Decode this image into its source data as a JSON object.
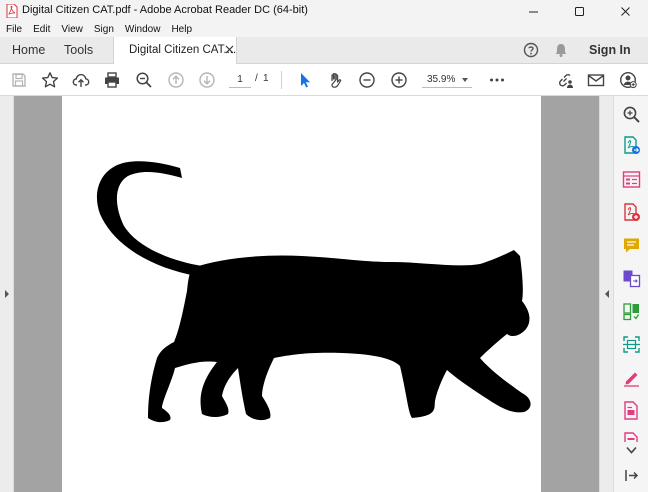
{
  "window": {
    "title": "Digital Citizen CAT.pdf - Adobe Acrobat Reader DC (64-bit)"
  },
  "menu": {
    "items": [
      "File",
      "Edit",
      "View",
      "Sign",
      "Window",
      "Help"
    ]
  },
  "tabs": {
    "home": "Home",
    "tools": "Tools",
    "document": "Digital Citizen CAT....",
    "sign_in": "Sign In"
  },
  "toolbar": {
    "page_current": "1",
    "page_separator": "/",
    "page_total": "1",
    "zoom": "35.9%"
  },
  "colors": {
    "accent_blue": "#1473e6",
    "pdf_red": "#d7373f",
    "pane_teal": "#0f9a89",
    "pane_yellow": "#e0a800",
    "pane_purple": "#6e49cb",
    "pane_green": "#2d9d3a",
    "pane_pink": "#e33b7e",
    "doc_background": "#a3a3a3"
  }
}
